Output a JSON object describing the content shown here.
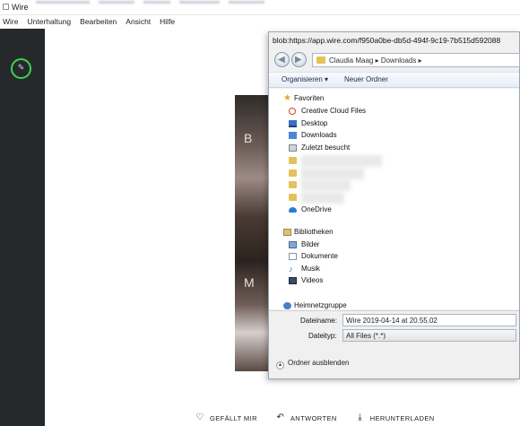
{
  "window": {
    "title": "Wire"
  },
  "menu": [
    "Wire",
    "Unterhaltung",
    "Bearbeiten",
    "Ansicht",
    "Hilfe"
  ],
  "image_letters": [
    "B",
    "M"
  ],
  "dialog": {
    "title": "blob:https://app.wire.com/f950a0be-db5d-494f-9c19-7b515d592088",
    "breadcrumb": "Claudia Maag  ▸  Downloads  ▸",
    "toolbar": {
      "organize": "Organisieren ▾",
      "new_folder": "Neuer Ordner"
    },
    "favorites_header": "Favoriten",
    "favorites": [
      {
        "label": "Creative Cloud Files",
        "icon": "creative-cloud-icon"
      },
      {
        "label": "Desktop",
        "icon": "desktop-icon"
      },
      {
        "label": "Downloads",
        "icon": "downloads-icon"
      },
      {
        "label": "Zuletzt besucht",
        "icon": "recent-places-icon"
      }
    ],
    "onedrive": "OneDrive",
    "libraries_header": "Bibliotheken",
    "libraries": [
      {
        "label": "Bilder",
        "icon": "pictures-icon"
      },
      {
        "label": "Dokumente",
        "icon": "documents-icon"
      },
      {
        "label": "Musik",
        "icon": "music-icon"
      },
      {
        "label": "Videos",
        "icon": "videos-icon"
      }
    ],
    "homegroup": "Heimnetzgruppe",
    "filename_label": "Dateiname:",
    "filename_value": "Wire 2019-04-14 at 20.55.02",
    "filetype_label": "Dateityp:",
    "filetype_value": "All Files (*.*)",
    "hide_folders": "Ordner ausblenden"
  },
  "actions": [
    {
      "label": "GEFÄLLT MIR",
      "icon": "heart-icon"
    },
    {
      "label": "ANTWORTEN",
      "icon": "reply-icon"
    },
    {
      "label": "HERUNTERLADEN",
      "icon": "download-icon"
    }
  ],
  "colors": {
    "sidebar": "#26292c",
    "avatar_ring": "#3fd24d",
    "dialog_bg": "#f0f0f0"
  }
}
